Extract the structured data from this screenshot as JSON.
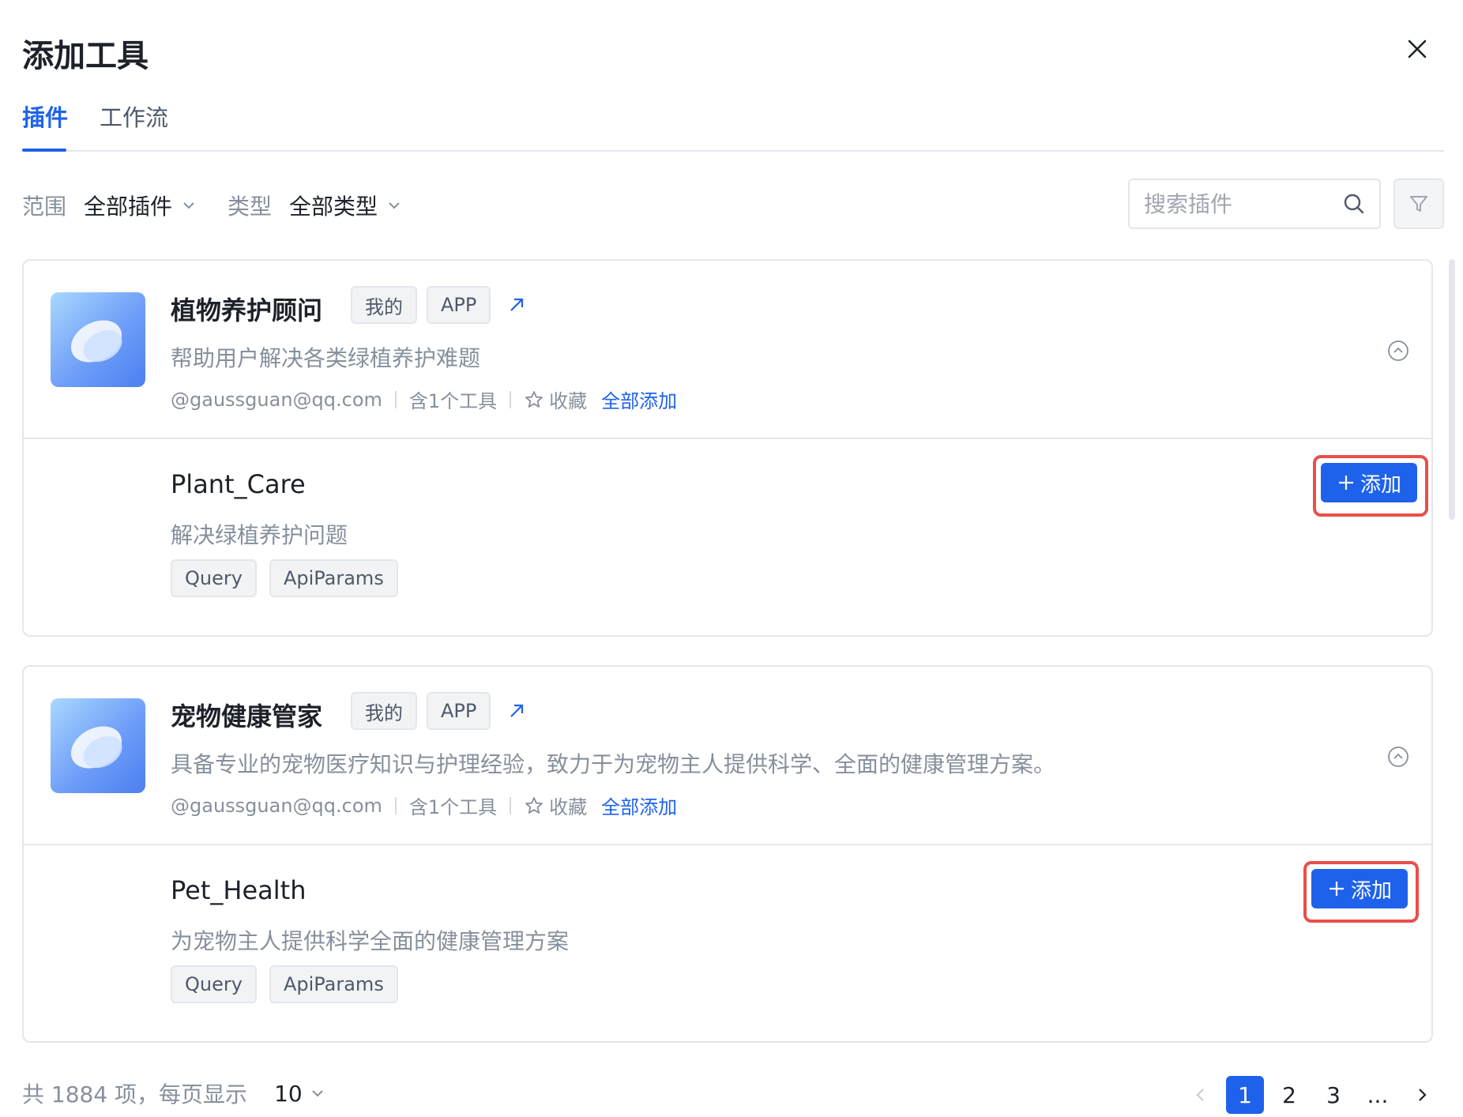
{
  "dialog": {
    "title": "添加工具"
  },
  "tabs": [
    {
      "label": "插件",
      "active": true
    },
    {
      "label": "工作流",
      "active": false
    }
  ],
  "filters": {
    "scope_label": "范围",
    "scope_value": "全部插件",
    "type_label": "类型",
    "type_value": "全部类型"
  },
  "search": {
    "placeholder": "搜索插件"
  },
  "plugins": [
    {
      "name": "植物养护顾问",
      "badges": [
        "我的",
        "APP"
      ],
      "description": "帮助用户解决各类绿植养护难题",
      "author": "@gaussguan@qq.com",
      "tool_count": "含1个工具",
      "favorite": "收藏",
      "add_all": "全部添加",
      "tools": [
        {
          "name": "Plant_Care",
          "description": "解决绿植养护问题",
          "params": [
            "Query",
            "ApiParams"
          ],
          "add_label": "添加"
        }
      ]
    },
    {
      "name": "宠物健康管家",
      "badges": [
        "我的",
        "APP"
      ],
      "description": "具备专业的宠物医疗知识与护理经验，致力于为宠物主人提供科学、全面的健康管理方案。",
      "author": "@gaussguan@qq.com",
      "tool_count": "含1个工具",
      "favorite": "收藏",
      "add_all": "全部添加",
      "tools": [
        {
          "name": "Pet_Health",
          "description": "为宠物主人提供科学全面的健康管理方案",
          "params": [
            "Query",
            "ApiParams"
          ],
          "add_label": "添加"
        }
      ]
    }
  ],
  "pagination": {
    "total_text": "共 1884 项，每页显示",
    "page_size": "10",
    "pages": [
      "1",
      "2",
      "3",
      "..."
    ],
    "current": "1"
  },
  "colors": {
    "accent": "#1e62ec",
    "highlight": "#e8504a"
  },
  "icons": {
    "close": "close-icon",
    "chevron": "chevron-down-icon",
    "search": "search-icon",
    "filter": "filter-icon",
    "external": "external-link-icon",
    "star": "star-icon",
    "collapse": "collapse-up-icon",
    "plus": "plus-icon",
    "prev": "chevron-left-icon",
    "next": "chevron-right-icon"
  }
}
